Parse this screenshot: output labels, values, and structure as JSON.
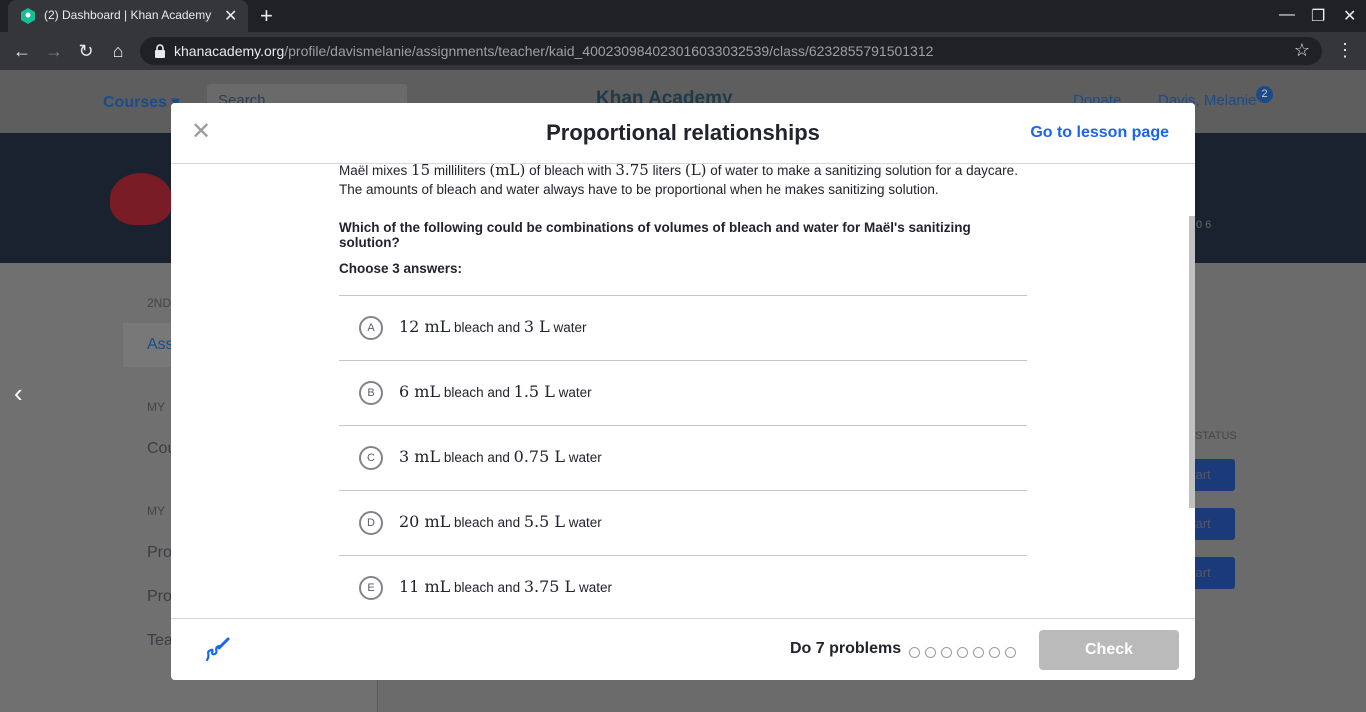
{
  "browser": {
    "tab_title": "(2) Dashboard | Khan Academy",
    "url_domain": "khanacademy.org",
    "url_path": "/profile/davismelanie/assignments/teacher/kaid_400230984023016033032539/class/6232855791501312"
  },
  "page": {
    "nav_courses": "Courses",
    "search_placeholder": "Search",
    "logo_text": "Khan Academy",
    "donate": "Donate",
    "user_name": "Davis, Melanie",
    "notification_count": "2",
    "stats": "0  6",
    "side_labels": [
      "2ND",
      "Ass",
      "MY",
      "Cou",
      "MY",
      "Pro",
      "Pro",
      "Tea"
    ],
    "status_header": "STATUS",
    "start_label": "tart"
  },
  "modal": {
    "title": "Proportional relationships",
    "lesson_link": "Go to lesson page",
    "problem_intro": "Maël mixes",
    "problem_amount1": "15",
    "problem_unit1_text": "milliliters",
    "problem_unit1": "(mL)",
    "problem_mid": "of bleach with",
    "problem_amount2": "3.75",
    "problem_unit2_text": "liters",
    "problem_unit2": "(L)",
    "problem_end": "of water to make a sanitizing solution for a daycare. The amounts of bleach and water always have to be proportional when he makes sanitizing solution.",
    "question": "Which of the following could be combinations of volumes of bleach and water for Maël's sanitizing solution?",
    "choose": "Choose 3 answers:",
    "choices": [
      {
        "letter": "A",
        "bleach": "12 mL",
        "water": "3 L"
      },
      {
        "letter": "B",
        "bleach": "6 mL",
        "water": "1.5 L"
      },
      {
        "letter": "C",
        "bleach": "3 mL",
        "water": "0.75 L"
      },
      {
        "letter": "D",
        "bleach": "20 mL",
        "water": "5.5 L"
      },
      {
        "letter": "E",
        "bleach": "11 mL",
        "water": "3.75 L"
      }
    ],
    "bleach_and": "bleach and",
    "water_word": "water",
    "do_problems": "Do 7 problems",
    "progress_total": 7,
    "progress_done": 0,
    "check_label": "Check"
  },
  "colors": {
    "accent": "#1865f2",
    "check_disabled": "#bababa"
  }
}
